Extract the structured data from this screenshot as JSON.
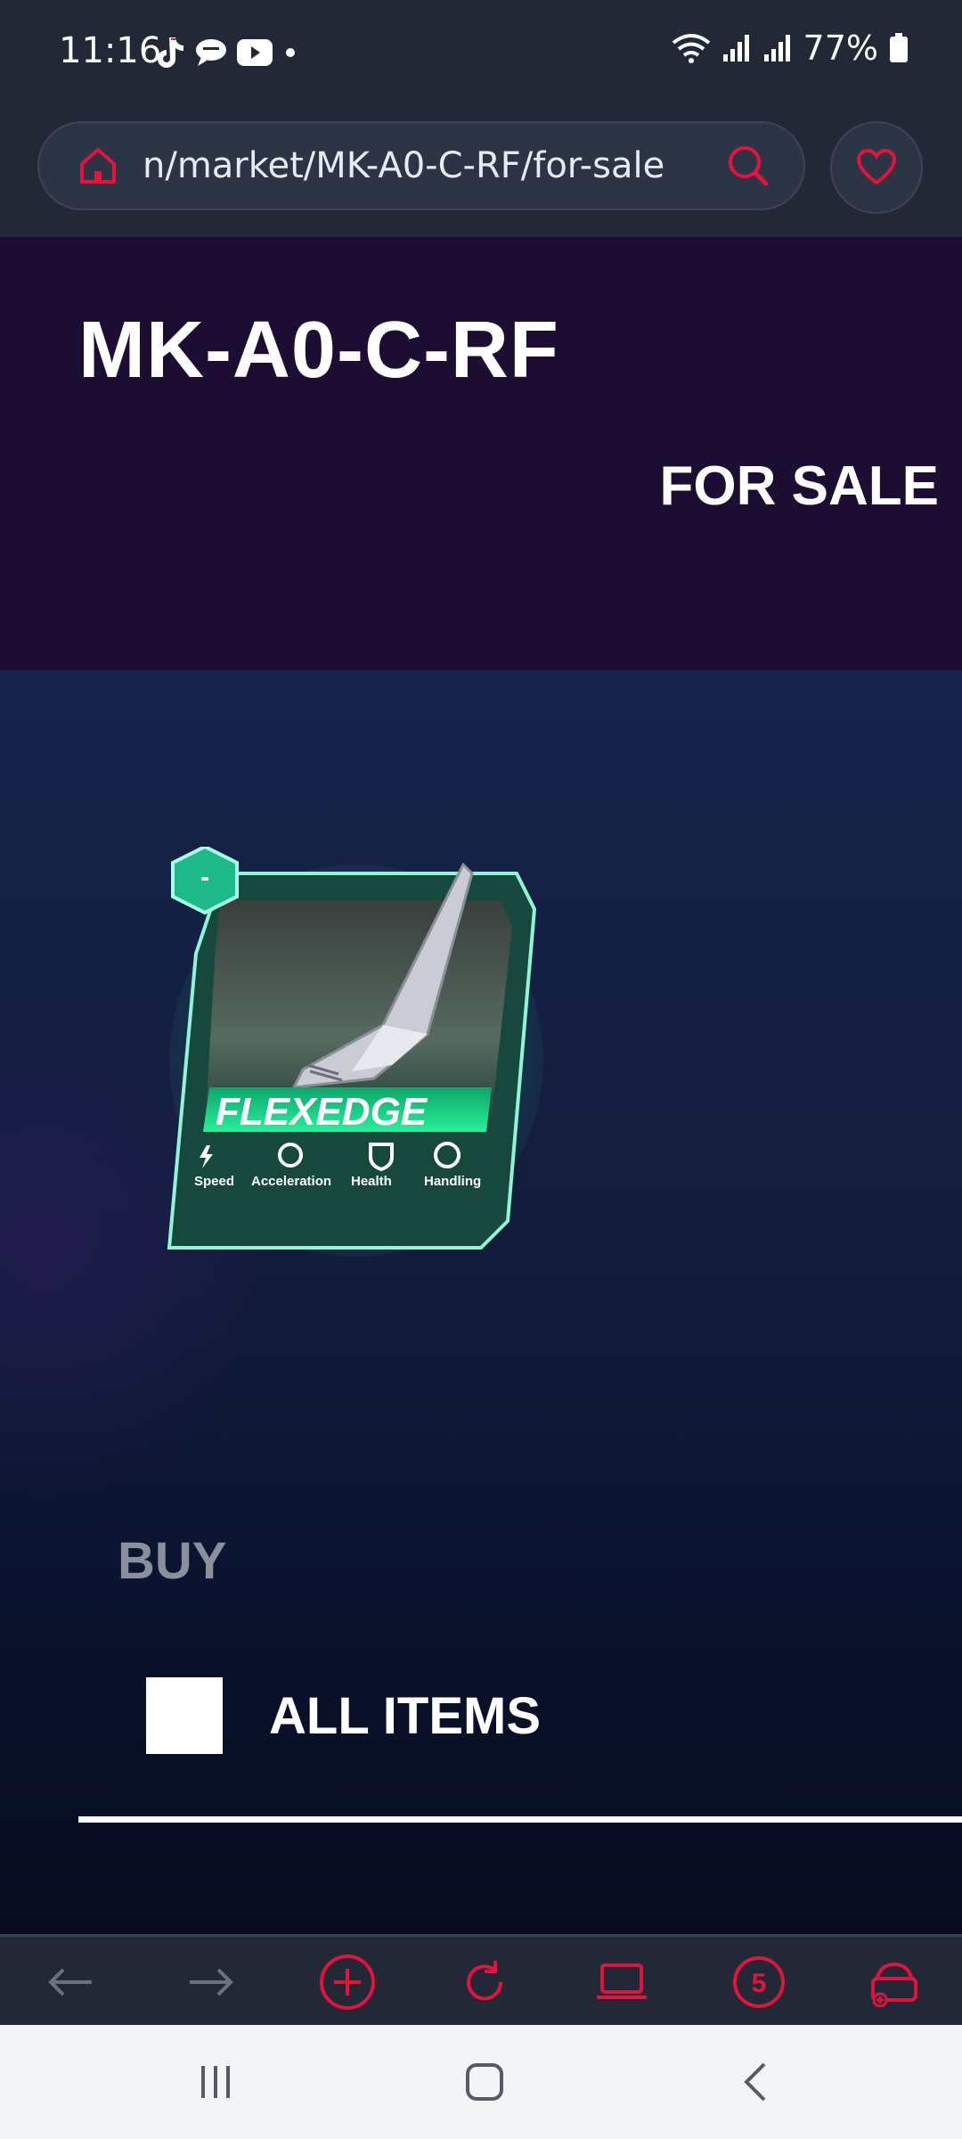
{
  "status_bar": {
    "time": "11:16",
    "battery": "77%",
    "icons": [
      "tiktok-icon",
      "chat-icon",
      "youtube-icon",
      "dot-icon",
      "wifi-icon",
      "signal-icon",
      "signal-icon",
      "battery-icon"
    ]
  },
  "browser": {
    "url": "n/market/MK-A0-C-RF/for-sale",
    "home_icon": "home-icon",
    "search_icon": "search-icon",
    "favorite_icon": "heart-icon",
    "accent_color": "#e0143c"
  },
  "hero": {
    "title": "MK-A0-C-RF",
    "subtitle": "FOR SALE",
    "background": "#1d0d33"
  },
  "card": {
    "badge": "-",
    "name": "FLEXEDGE",
    "stats": [
      "Speed",
      "Acceleration",
      "Health",
      "Handling"
    ],
    "rarity_color": "#2ee8a0"
  },
  "buy_section": {
    "label": "BUY",
    "filter_label": "ALL ITEMS"
  },
  "bottom_toolbar": {
    "items": [
      "back-icon",
      "forward-icon",
      "new-tab-icon",
      "reload-icon",
      "desktop-icon",
      "tabs-count-icon",
      "wallet-icon"
    ],
    "tab_count": "5"
  },
  "system_nav": {
    "items": [
      "recents-icon",
      "home-icon",
      "back-icon"
    ]
  }
}
